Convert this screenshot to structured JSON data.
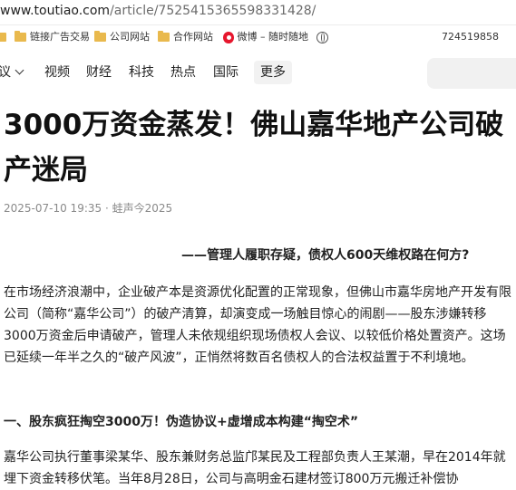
{
  "browser": {
    "url_host": "www.toutiao.com",
    "url_path": "/article/7525415365598331428/"
  },
  "bookmarks": [
    {
      "label": "",
      "icon": "folder-icon"
    },
    {
      "label": "链接广告交易",
      "icon": "folder-icon"
    },
    {
      "label": "公司网站",
      "icon": "folder-icon"
    },
    {
      "label": "合作网站",
      "icon": "folder-icon"
    },
    {
      "label": "微博 – 随时随地",
      "icon": "weibo-icon"
    },
    {
      "label": "",
      "icon": "globe-icon"
    },
    {
      "label": "724519858",
      "icon": ""
    }
  ],
  "nav": {
    "items": [
      "议",
      "视频",
      "财经",
      "科技",
      "热点",
      "国际"
    ],
    "more": "更多"
  },
  "article": {
    "title": "3000万资金蒸发！佛山嘉华地产公司破产迷局",
    "meta": "2025-07-10 19:35 · 蛙声今2025",
    "subtitle": "——管理人履职存疑，债权人600天维权路在何方?",
    "paragraph1": "在市场经济浪潮中，企业破产本是资源优化配置的正常现象，但佛山市嘉华房地产开发有限公司（简称“嘉华公司”）的破产清算，却演变成一场触目惊心的闹剧——股东涉嫌转移3000万资金后申请破产，管理人未依规组织现场债权人会议、以较低价格处置资产。这场已延续一年半之久的“破产风波”，正悄然将数百名债权人的合法权益置于不利境地。",
    "heading1": "一、股东疯狂掏空3000万！伪造协议+虚增成本构建“掏空术”",
    "paragraph2": "嘉华公司执行董事梁某华、股东兼财务总监邝某民及工程部负责人王某潮，早在2014年就埋下资金转移伏笔。当年8月28日，公司与高明金石建材签订800万元搬迁补偿协"
  }
}
